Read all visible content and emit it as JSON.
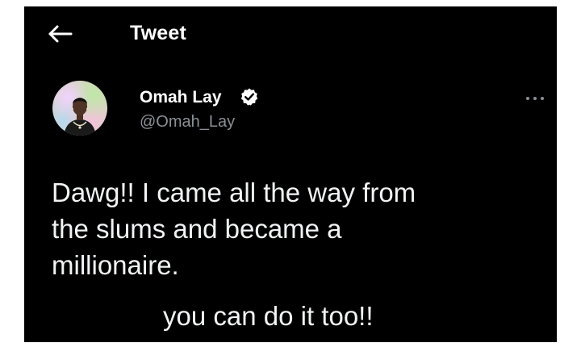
{
  "header": {
    "title": "Tweet",
    "back_icon": "arrow-left-icon"
  },
  "author": {
    "name": "Omah Lay",
    "handle": "@Omah_Lay",
    "verified": true,
    "verified_icon": "verified-badge-icon",
    "avatar_icon": "profile-avatar"
  },
  "menu": {
    "more_icon": "more-options-icon"
  },
  "tweet": {
    "text": "Dawg!! I came all the way from\nthe slums and became a\nmillionaire.",
    "text_line2": "you can do it too!!"
  },
  "colors": {
    "background": "#000000",
    "text": "#e7e9ea",
    "secondary_text": "#8b9096",
    "verified_badge": "#ffffff"
  }
}
